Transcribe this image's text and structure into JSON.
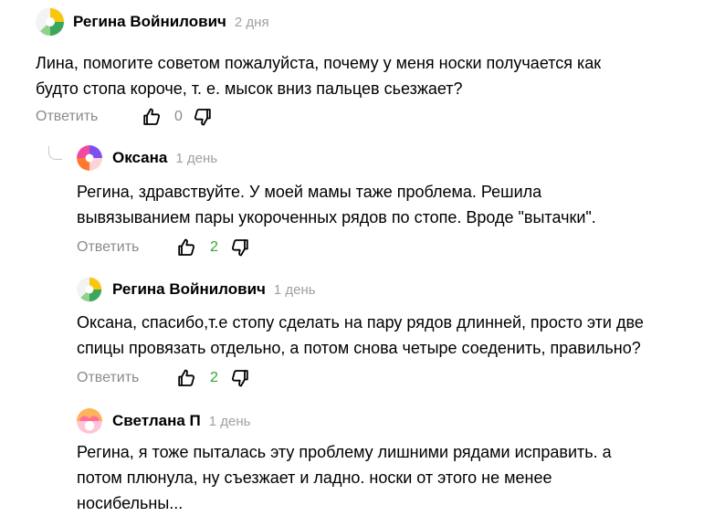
{
  "comments": [
    {
      "author": "Регина Войнилович",
      "date": "2 дня",
      "text_lines": [
        "Лина, помогите советом пожалуйста, почему у меня носки получается как",
        "будто стопа короче, т. е. мысок вниз пальцев сьезжает?"
      ],
      "reply_label": "Ответить",
      "likes": "0"
    },
    {
      "author": "Оксана",
      "date": "1 день",
      "text_lines": [
        "Регина, здравствуйте. У моей мамы таже проблема. Решила",
        "вывязыванием пары укороченных рядов по стопе. Вроде \"вытачки\"."
      ],
      "reply_label": "Ответить",
      "likes": "2"
    },
    {
      "author": "Регина Войнилович",
      "date": "1 день",
      "text_lines": [
        "Оксана, спасибо,т.е стопу сделать на пару рядов длинней, просто эти две",
        "спицы провязать отдельно, а потом снова четыре соеденить, правильно?"
      ],
      "reply_label": "Ответить",
      "likes": "2"
    },
    {
      "author": "Светлана П",
      "date": "1 день",
      "text_lines": [
        "Регина, я тоже пыталась эту проблему лишними рядами исправить. а",
        "потом плюнула, ну съезжает и ладно. носки от этого не менее",
        "носибельны..."
      ]
    }
  ],
  "icons": {
    "avatar_regina": "yandex-zen-avatar-icon",
    "avatar_oksana": "colorful-avatar-icon",
    "avatar_svetlana": "pink-avatar-icon",
    "like": "thumbs-up-icon",
    "dislike": "thumbs-down-icon"
  },
  "colors": {
    "like_positive": "#2aa830",
    "muted": "#8b8b8b"
  }
}
